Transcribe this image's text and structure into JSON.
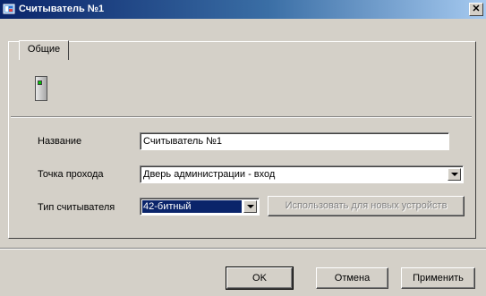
{
  "window": {
    "title": "Считыватель №1",
    "close_symbol": "✕",
    "app_icon": "reader-app-icon"
  },
  "tabs": [
    {
      "label": "Общие",
      "active": true
    }
  ],
  "form": {
    "name_label": "Название",
    "name_value": "Считыватель №1",
    "passage_label": "Точка прохода",
    "passage_value": "Дверь администрации - вход",
    "reader_type_label": "Тип считывателя",
    "reader_type_value": "42-битный",
    "use_for_new_devices_label": "Использовать для новых устройств",
    "use_for_new_devices_enabled": false
  },
  "buttons": {
    "ok": "OK",
    "cancel": "Отмена",
    "apply": "Применить"
  },
  "colors": {
    "titlebar": "#0a246a",
    "dialog_face": "#d4d0c8",
    "selection": "#0a246a"
  }
}
